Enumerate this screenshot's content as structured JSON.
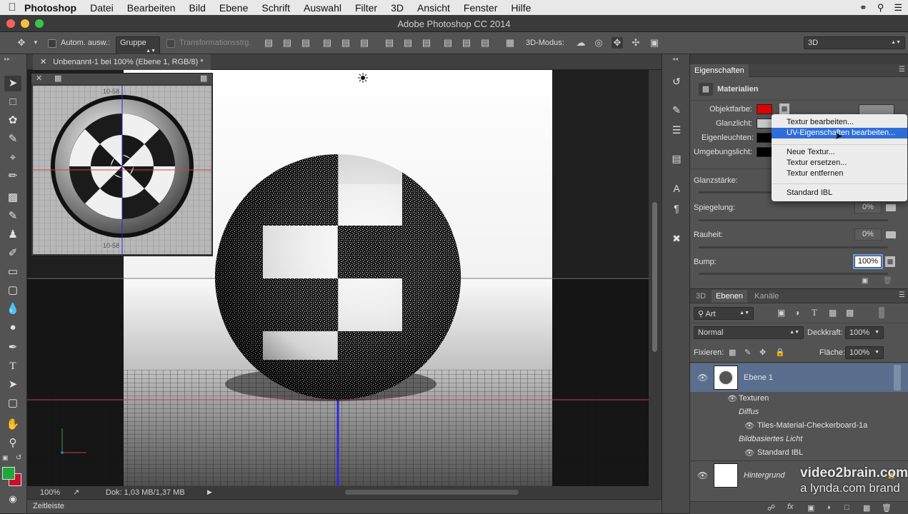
{
  "menubar": {
    "app_name": "Photoshop",
    "items": [
      "Datei",
      "Bearbeiten",
      "Bild",
      "Ebene",
      "Schrift",
      "Auswahl",
      "Filter",
      "3D",
      "Ansicht",
      "Fenster",
      "Hilfe"
    ]
  },
  "window": {
    "title": "Adobe Photoshop CC 2014"
  },
  "options": {
    "auto_select_label": "Autom. ausw.:",
    "auto_select_value": "Gruppe",
    "transform_label": "Transformationsstrg.",
    "mode_3d_label": "3D-Modus:",
    "workspace_value": "3D"
  },
  "document": {
    "tab_title": "Unbenannt-1 bei 100% (Ebene 1, RGB/8) *"
  },
  "texture_window": {
    "ruler_label_top": "10-58",
    "ruler_label_bottom": "10-58"
  },
  "status": {
    "zoom": "100%",
    "doc_size": "Dok: 1,03 MB/1,37 MB"
  },
  "timeline": {
    "label": "Zeitleiste"
  },
  "properties": {
    "panel_tab": "Eigenschaften",
    "section_title": "Materialien",
    "diffuse_label": "Objektfarbe:",
    "specular_label": "Glanzlicht:",
    "illumination_label": "Eigenleuchten:",
    "ambient_label": "Umgebungslicht:",
    "shine_label": "Glanzstärke:",
    "reflection_label": "Spiegelung:",
    "reflection_value": "0%",
    "roughness_label": "Rauheit:",
    "roughness_value": "0%",
    "bump_label": "Bump:",
    "bump_value": "100%",
    "colors": {
      "diffuse": "#e00000",
      "specular": "#c8c8c8",
      "illumination": "#000000",
      "ambient": "#000000"
    }
  },
  "context_menu": {
    "items": [
      "Textur bearbeiten...",
      "UV-Eigenschaften bearbeiten...",
      "Neue Textur...",
      "Textur ersetzen...",
      "Textur entfernen",
      "Standard IBL"
    ],
    "highlighted": "UV-Eigenschaften bearbeiten..."
  },
  "layers": {
    "tabs": [
      "3D",
      "Ebenen",
      "Kanäle"
    ],
    "active_tab": "Ebenen",
    "filter_value": "Art",
    "blend_mode": "Normal",
    "opacity_label": "Deckkraft:",
    "opacity_value": "100%",
    "lock_label": "Fixieren:",
    "fill_label": "Fläche:",
    "fill_value": "100%",
    "layer1_name": "Ebene 1",
    "textures_label": "Texturen",
    "diffuse_label": "Diffus",
    "diffuse_texture": "Tiles-Material-Checkerboard-1a",
    "ibl_label": "Bildbasiertes Licht",
    "ibl_value": "Standard IBL",
    "background_name": "Hintergrund"
  },
  "watermark": {
    "line1": "video2brain.com",
    "line2": "a lynda.com brand"
  }
}
